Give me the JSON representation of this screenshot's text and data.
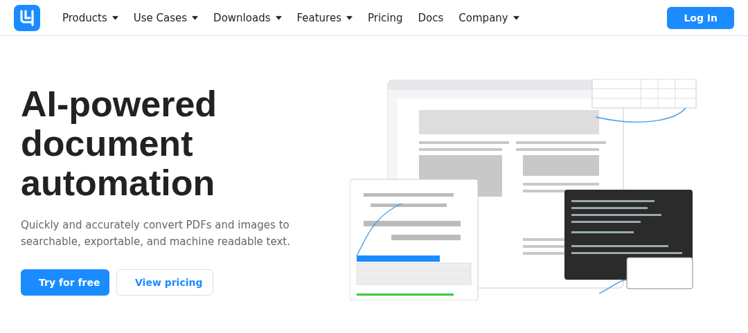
{
  "nav": {
    "items": [
      {
        "label": "Products",
        "has_menu": true
      },
      {
        "label": "Use Cases",
        "has_menu": true
      },
      {
        "label": "Downloads",
        "has_menu": true
      },
      {
        "label": "Features",
        "has_menu": true
      },
      {
        "label": "Pricing",
        "has_menu": false
      },
      {
        "label": "Docs",
        "has_menu": false
      },
      {
        "label": "Company",
        "has_menu": true
      }
    ],
    "login": "Log In"
  },
  "hero": {
    "title": "AI-powered document automation",
    "subtitle": "Quickly and accurately convert PDFs and images to searchable, exportable, and machine readable text.",
    "buttons": [
      {
        "label": "Try for free",
        "kind": "primary"
      },
      {
        "label": "View pricing",
        "kind": "secondary"
      }
    ]
  }
}
